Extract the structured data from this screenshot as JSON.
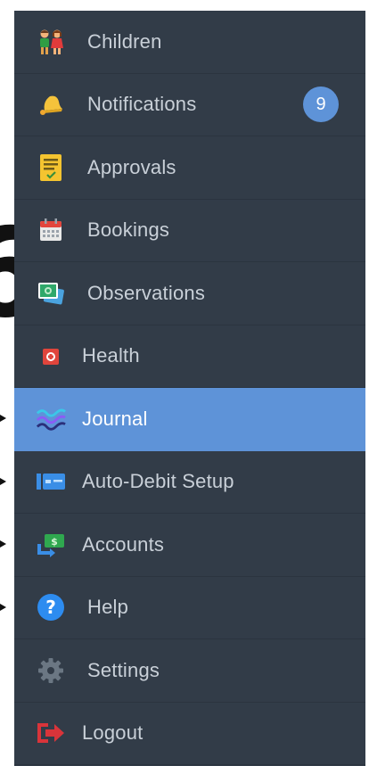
{
  "menu": {
    "items": [
      {
        "label": "Children",
        "icon": "children-icon"
      },
      {
        "label": "Notifications",
        "icon": "bell-icon",
        "badge": "9"
      },
      {
        "label": "Approvals",
        "icon": "clipboard-check-icon"
      },
      {
        "label": "Bookings",
        "icon": "calendar-icon"
      },
      {
        "label": "Observations",
        "icon": "photos-icon"
      },
      {
        "label": "Health",
        "icon": "medical-kit-icon"
      },
      {
        "label": "Journal",
        "icon": "journal-wave-icon",
        "active": true
      },
      {
        "label": "Auto-Debit Setup",
        "icon": "credit-card-icon"
      },
      {
        "label": "Accounts",
        "icon": "money-transfer-icon"
      },
      {
        "label": "Help",
        "icon": "help-icon"
      },
      {
        "label": "Settings",
        "icon": "gear-icon"
      },
      {
        "label": "Logout",
        "icon": "logout-icon"
      }
    ]
  },
  "background": {
    "cropped_glyph": "6"
  },
  "colors": {
    "menu_bg": "#323c48",
    "active_bg": "#5e93d8",
    "badge_bg": "#5e93d8",
    "label_text": "#c9d0d8"
  }
}
